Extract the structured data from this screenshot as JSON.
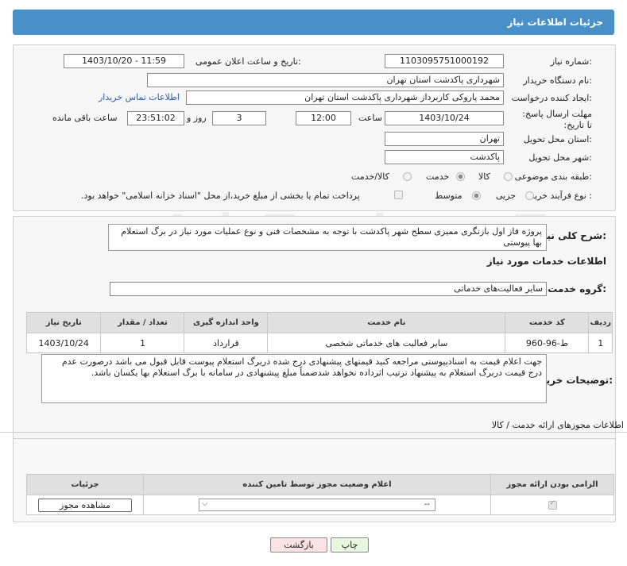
{
  "header": {
    "title": "جزئیات اطلاعات نیاز"
  },
  "form": {
    "need_number_label": "شماره نیاز:",
    "need_number": "1103095751000192",
    "announce_label": "تاریخ و ساعت اعلان عمومی:",
    "announce_value": "1403/10/20 - 11:59",
    "buyer_label": "نام دستگاه خریدار:",
    "buyer_value": "شهرداری پاکدشت استان تهران",
    "creator_label": "ایجاد کننده درخواست:",
    "creator_value": "محمد پاروکی کاربرداز شهرداری پاکدشت استان تهران",
    "contact_link": "اطلاعات تماس خریدار",
    "deadline_label": "مهلت ارسال پاسخ: تا تاریخ:",
    "deadline_date": "1403/10/24",
    "time_label": "ساعت",
    "deadline_time": "12:00",
    "days_value": "3",
    "days_label": "روز و",
    "remaining_time": "23:51:02",
    "remaining_label": "ساعت باقی مانده",
    "province_label": "استان محل تحویل:",
    "province_value": "تهران",
    "city_label": "شهر محل تحویل:",
    "city_value": "پاکدشت",
    "category_label": "طبقه بندی موضوعی:",
    "category_options": [
      "کالا",
      "خدمت",
      "کالا/خدمت"
    ],
    "category_selected": "خدمت",
    "process_label": "نوع فرآیند خرید :",
    "process_options": [
      "جزیی",
      "متوسط"
    ],
    "process_selected": "متوسط",
    "payment_note": "پرداخت تمام یا بخشی از مبلغ خرید،از محل \"اسناد خزانه اسلامی\" خواهد بود."
  },
  "description": {
    "label": "شرح کلی نیاز:",
    "text": "پروژه فاز اول بازنگری ممیزی سطح شهر پاکدشت با توجه به مشخصات فنی و نوع عملیات مورد نیاز در برگ استعلام بها پیوستی"
  },
  "services": {
    "section_title": "اطلاعات خدمات مورد نیاز",
    "group_label": "گروه خدمت:",
    "group_value": "سایر فعالیت‌های خدماتی",
    "columns": [
      "ردیف",
      "کد خدمت",
      "نام خدمت",
      "واحد اندازه گیری",
      "تعداد / مقدار",
      "تاریخ نیاز"
    ],
    "rows": [
      {
        "index": "1",
        "code": "ط-96-960",
        "name": "سایر فعالیت های خدماتی شخصی",
        "unit": "قرارداد",
        "qty": "1",
        "date": "1403/10/24"
      }
    ]
  },
  "buyer_notes": {
    "label": "توضیحات خریدار:",
    "text": "جهت اعلام قیمت به اسنادپیوستی مراجعه کنید قیمتهای پیشنهادی درج شده دربرگ استعلام پیوست قابل قبول می باشد درصورت عدم درج قیمت دربرگ استعلام به پیشنهاد ترتیب اثرداده نخواهد شدضمناً مبلغ پیشنهادی در سامانه با برگ استعلام بها یکسان باشد."
  },
  "permits": {
    "title": "اطلاعات مجوزهای ارائه خدمت / کالا",
    "columns": [
      "الزامی بودن ارائه مجوز",
      "اعلام وضعیت مجوز توسط تامین کننده",
      "جزئیات"
    ],
    "select_value": "--",
    "view_button": "مشاهده مجوز"
  },
  "buttons": {
    "print": "چاپ",
    "back": "بازگشت"
  },
  "watermark": "AriaTender.neT",
  "colors": {
    "header": "#4a90c8",
    "link": "#2a5db0",
    "print_btn": "#e8f8e0",
    "back_btn": "#fbe3e3"
  }
}
